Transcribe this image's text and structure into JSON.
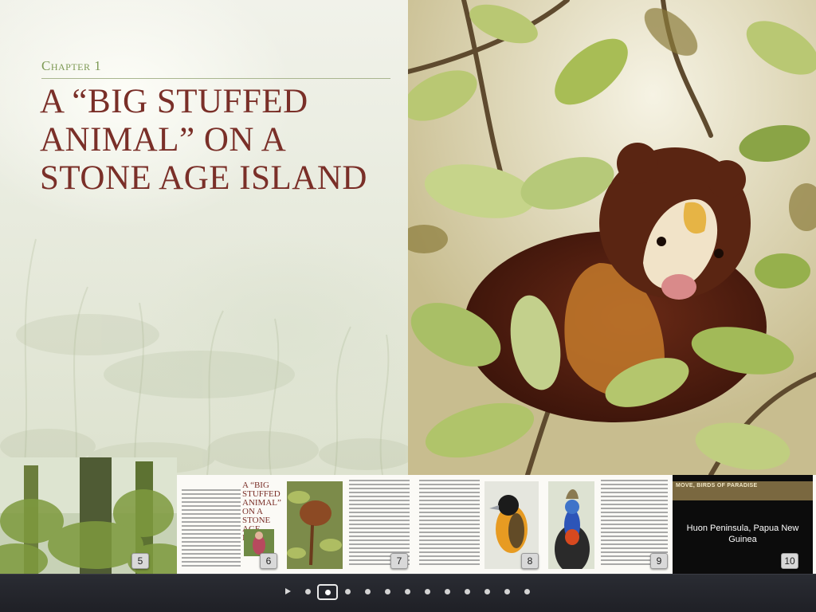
{
  "chapter": {
    "label": "Chapter 1",
    "title": "A “Big Stuffed Animal” on a Stone Age Island"
  },
  "thumbnails": [
    {
      "page": "5"
    },
    {
      "page": "6",
      "mini_title": "A “Big Stuffed Animal” on a Stone Age Island"
    },
    {
      "page": "7"
    },
    {
      "page": "8"
    },
    {
      "page": "9"
    },
    {
      "page": "10",
      "header": "MOVE, BIRDS OF PARADISE",
      "caption": "Huon Peninsula, Papua New Guinea"
    }
  ],
  "navigation": {
    "play_icon": "play-icon",
    "total_dots": 12,
    "current_index": 1
  },
  "colors": {
    "chapter_label": "#7e9a55",
    "chapter_title": "#7a2f28",
    "nav_background": "#23242a"
  }
}
